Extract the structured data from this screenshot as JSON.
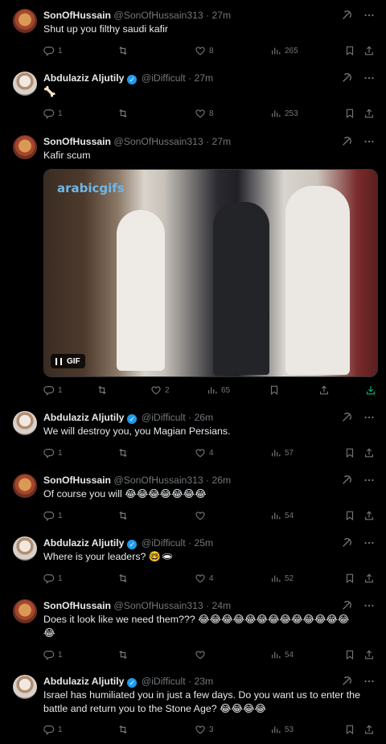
{
  "tweets": [
    {
      "name": "SonOfHussain",
      "handle": "@SonOfHussain313",
      "time": "27m",
      "text": "Shut up you filthy saudi kafir",
      "replies": "1",
      "retweets": "",
      "likes": "8",
      "views": "265",
      "verified": false
    },
    {
      "name": "Abdulaziz Aljutily",
      "handle": "@iDifficult",
      "time": "27m",
      "text": "🦴",
      "replies": "1",
      "retweets": "",
      "likes": "8",
      "views": "253",
      "verified": true
    },
    {
      "name": "SonOfHussain",
      "handle": "@SonOfHussain313",
      "time": "27m",
      "text": "Kafir scum",
      "replies": "1",
      "retweets": "",
      "likes": "2",
      "views": "65",
      "verified": false
    },
    {
      "name": "Abdulaziz Aljutily",
      "handle": "@iDifficult",
      "time": "26m",
      "text": "We will destroy you, you Magian Persians.",
      "replies": "1",
      "retweets": "",
      "likes": "4",
      "views": "57",
      "verified": true
    },
    {
      "name": "SonOfHussain",
      "handle": "@SonOfHussain313",
      "time": "26m",
      "text": "Of course you will 😂😂😂😂😂😂😂",
      "replies": "1",
      "retweets": "",
      "likes": "",
      "views": "54",
      "verified": false
    },
    {
      "name": "Abdulaziz Aljutily",
      "handle": "@iDifficult",
      "time": "25m",
      "text": "Where is your leaders? 🤓🕳",
      "replies": "1",
      "retweets": "",
      "likes": "4",
      "views": "52",
      "verified": true
    },
    {
      "name": "SonOfHussain",
      "handle": "@SonOfHussain313",
      "time": "24m",
      "text": "Does it look like we need them??? 😂😂😂😂😂😂😂😂😂😂😂😂😂",
      "text2": "😂",
      "replies": "1",
      "retweets": "",
      "likes": "",
      "views": "54",
      "verified": false
    },
    {
      "name": "Abdulaziz Aljutily",
      "handle": "@iDifficult",
      "time": "23m",
      "text": "Israel has humiliated you in just a few days. Do you want us to enter the battle and return you to the Stone Age? 😂😂😂😂",
      "replies": "1",
      "retweets": "",
      "likes": "3",
      "views": "53",
      "verified": true
    }
  ],
  "media": {
    "logo_text": "arabicgifs",
    "badge_label": "GIF"
  },
  "separator": "·",
  "colors": {
    "background": "#000000",
    "text": "#e7e9ea",
    "muted": "#71767b",
    "verified": "#1d9bf0"
  },
  "icons": {
    "reply": "reply-icon",
    "retweet": "retweet-icon",
    "like": "heart-icon",
    "views": "views-icon",
    "bookmark": "bookmark-icon",
    "share": "share-icon",
    "download": "download-icon",
    "grok": "grok-icon",
    "more": "more-icon",
    "verified": "verified-badge-icon"
  }
}
